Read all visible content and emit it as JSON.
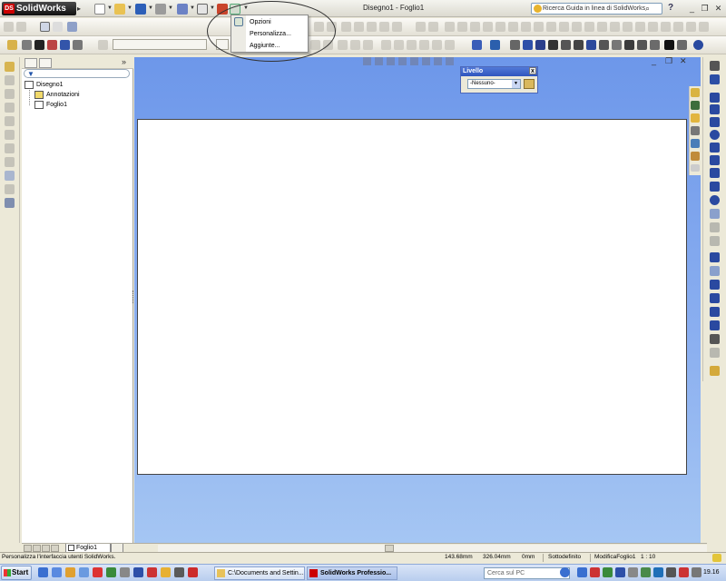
{
  "app": {
    "name": "SolidWorks",
    "logo_mark": "DS",
    "document_title": "Disegno1 - Foglio1",
    "search_placeholder": "Ricerca Guida in linea di SolidWorks",
    "help": "?"
  },
  "options_menu": {
    "items": [
      {
        "label": "Opzioni"
      },
      {
        "label": "Personalizza..."
      },
      {
        "label": "Aggiunte..."
      }
    ]
  },
  "feature_tree": {
    "root": "Disegno1",
    "children": [
      "Annotazioni",
      "Foglio1"
    ],
    "collapse": "»"
  },
  "level_box": {
    "title": "Livello",
    "close": "x",
    "selected": "-Nessuno-"
  },
  "sheet_tabs": {
    "active": "Foglio1"
  },
  "status_bar": {
    "message": "Personalizza l'interfaccia utenti SolidWorks.",
    "x_coord": "143.68mm",
    "y_coord": "326.04mm",
    "z_coord": "0mm",
    "state": "Sottodefinito",
    "mode": "ModificaFoglio1",
    "scale": "1 : 10"
  },
  "taskbar": {
    "start": "Start",
    "tasks": [
      {
        "label": "C:\\Documents and Settin..."
      },
      {
        "label": "SolidWorks Professio..."
      }
    ],
    "search_placeholder": "Cerca sul PC",
    "clock": "19.16"
  },
  "colors": {
    "canvas_top": "#6d97ea",
    "canvas_bottom": "#a5c6f3",
    "level_header": "#2f55be",
    "logo_red": "#cc0000"
  }
}
